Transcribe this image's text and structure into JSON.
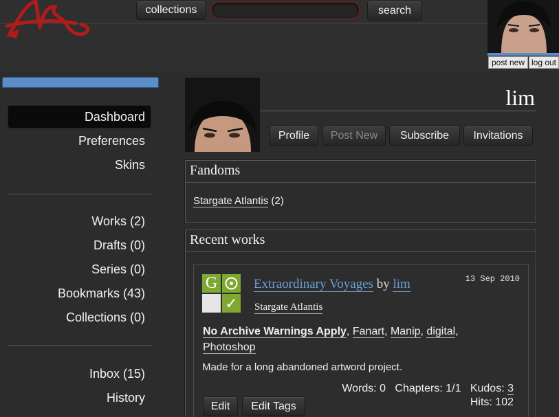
{
  "header": {
    "collections_label": "collections",
    "search_placeholder": "",
    "search_label": "search",
    "post_new_label": "post new",
    "log_out_label": "log out"
  },
  "sidebar": {
    "items": [
      {
        "label": "Dashboard",
        "active": true
      },
      {
        "label": "Preferences"
      },
      {
        "label": "Skins"
      },
      {
        "label": "Works (2)"
      },
      {
        "label": "Drafts (0)"
      },
      {
        "label": "Series (0)"
      },
      {
        "label": "Bookmarks (43)"
      },
      {
        "label": "Collections (0)"
      },
      {
        "label": "Inbox (15)"
      },
      {
        "label": "History"
      }
    ]
  },
  "user": {
    "name": "lim",
    "tabs": [
      "Profile",
      "Post New",
      "Subscribe",
      "Invitations"
    ]
  },
  "fandoms": {
    "heading": "Fandoms",
    "items": [
      {
        "name": "Stargate Atlantis",
        "count": "(2)"
      }
    ]
  },
  "recent": {
    "heading": "Recent works",
    "work": {
      "rating_letter": "G",
      "title": "Extraordinary Voyages",
      "by": "by",
      "author": "lim",
      "date": "13 Sep 2010",
      "fandom": "Stargate Atlantis",
      "tags": [
        "No Archive Warnings Apply",
        "Fanart",
        "Manip",
        "digital",
        "Photoshop"
      ],
      "summary": "Made for a long abandoned artword project.",
      "words_label": "Words:",
      "words": "0",
      "chapters_label": "Chapters:",
      "chapters": "1/1",
      "kudos_label": "Kudos:",
      "kudos": "3",
      "hits_label": "Hits:",
      "hits": "102",
      "edit_label": "Edit",
      "edit_tags_label": "Edit Tags"
    }
  },
  "colors": {
    "accent_blue": "#5b8ec9",
    "rating_green": "#7fa832",
    "logo_red": "#b01c1c"
  }
}
